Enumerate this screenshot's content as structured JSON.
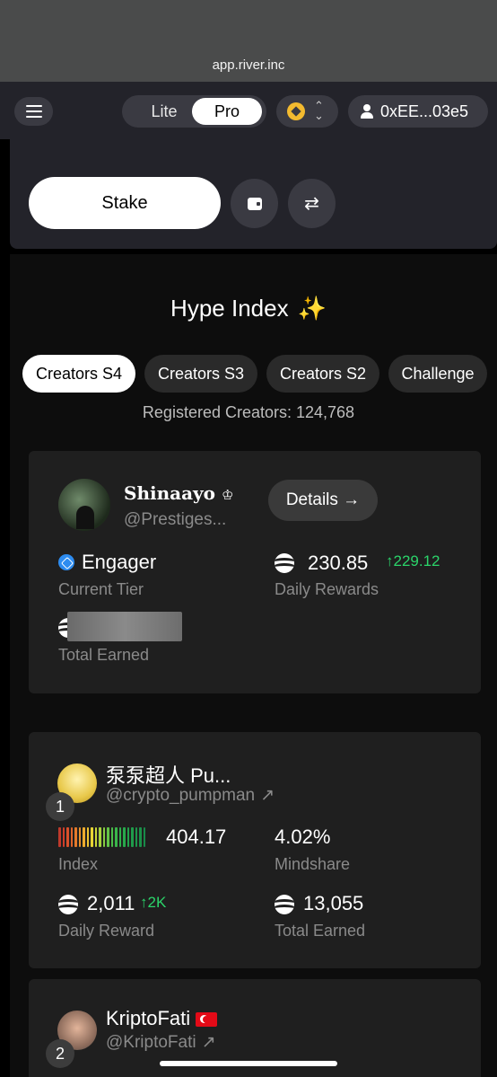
{
  "browser": {
    "url": "app.river.inc"
  },
  "header": {
    "mode_options": [
      "Lite",
      "Pro"
    ],
    "active_mode": "Pro",
    "chain_icon": "bnb-icon",
    "wallet_address": "0xEE...03e5"
  },
  "stake": {
    "stake_label": "Stake",
    "wallet_icon": "wallet-icon",
    "swap_icon": "swap-icon"
  },
  "hype": {
    "title": "Hype Index",
    "sparkle": "✨",
    "tabs": [
      "Creators S4",
      "Creators S3",
      "Creators S2",
      "Challenge"
    ],
    "active_tab": "Creators S4",
    "registered": "Registered Creators: 124,768"
  },
  "my_card": {
    "name": "Shinaayo",
    "crown": "♔",
    "handle": "@Prestiges...",
    "details_label": "Details →",
    "tier_value": "Engager",
    "tier_label": "Current Tier",
    "daily_rewards_value": "230.85",
    "daily_rewards_delta": "↑229.12",
    "daily_rewards_label": "Daily Rewards",
    "total_earned_label": "Total Earned"
  },
  "leaders": [
    {
      "rank": "1",
      "name": "泵泵超人 Pu...",
      "handle": "@crypto_pumpman",
      "link_icon": "↗",
      "index_value": "404.17",
      "index_label": "Index",
      "mindshare_value": "4.02%",
      "mindshare_label": "Mindshare",
      "daily_reward_value": "2,011",
      "daily_reward_delta": "↑2K",
      "daily_reward_label": "Daily Reward",
      "total_earned_value": "13,055",
      "total_earned_label": "Total Earned"
    },
    {
      "rank": "2",
      "name": "KriptoFati",
      "handle": "@KriptoFati",
      "link_icon": "↗"
    }
  ],
  "colors": {
    "accent_green": "#2bd46a",
    "card_bg": "#1f1f1f",
    "tier_blue": "#2d8cf0",
    "sparkle": "#b78cf7"
  }
}
